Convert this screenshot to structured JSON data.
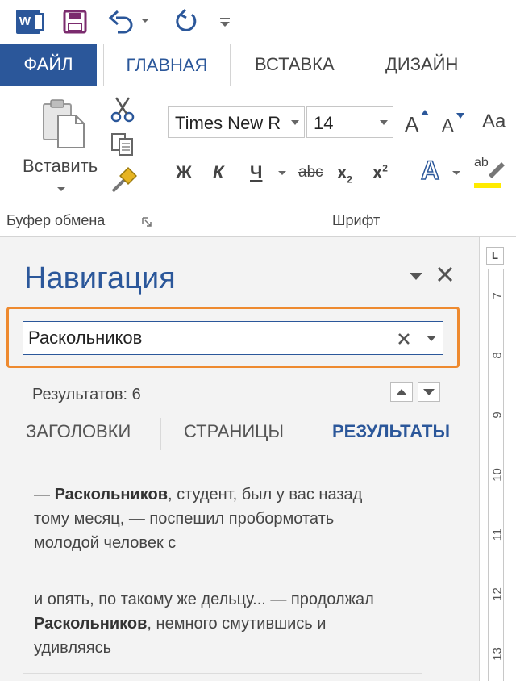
{
  "qat": {
    "app_icon": "word-icon",
    "app_letter": "W",
    "icons": [
      "save-icon",
      "undo-icon",
      "redo-icon",
      "customize-qat-icon"
    ]
  },
  "tabs": [
    {
      "label": "ФАЙЛ",
      "active": false
    },
    {
      "label": "ГЛАВНАЯ",
      "active": true
    },
    {
      "label": "ВСТАВКА",
      "active": false
    },
    {
      "label": "ДИЗАЙН",
      "active": false
    }
  ],
  "ribbon": {
    "clipboard": {
      "paste_label": "Вставить",
      "group_label": "Буфер обмена"
    },
    "font": {
      "font_name": "Times New R",
      "font_size": "14",
      "grow_label": "A",
      "shrink_label": "A",
      "case_label": "Aa",
      "bold": "Ж",
      "italic": "К",
      "underline": "Ч",
      "strike": "abc",
      "subscript": "x",
      "subscript_mark": "2",
      "superscript": "x",
      "superscript_mark": "2",
      "effects": "A",
      "highlight": "ab",
      "group_label": "Шрифт"
    }
  },
  "navigation": {
    "title": "Навигация",
    "search_value": "Раскольников",
    "results_count": "Результатов: 6",
    "tabs": [
      {
        "label": "ЗАГОЛОВКИ",
        "active": false
      },
      {
        "label": "СТРАНИЦЫ",
        "active": false
      },
      {
        "label": "РЕЗУЛЬТАТЫ",
        "active": true
      }
    ],
    "results": [
      {
        "before": "— ",
        "match": "Раскольников",
        "after": ", студент, был у вас назад тому месяц, — поспешил пробормотать молодой человек с"
      },
      {
        "before": "и опять, по такому же дельцу... — продолжал ",
        "match": "Раскольников",
        "after": ", немного смутившись и удивляясь"
      }
    ]
  },
  "ruler": {
    "tab_selector": "L",
    "numbers": [
      "7",
      "8",
      "9",
      "10",
      "11",
      "12",
      "13"
    ]
  },
  "colors": {
    "accent": "#2b579a",
    "search_highlight": "#ee8a2f"
  }
}
